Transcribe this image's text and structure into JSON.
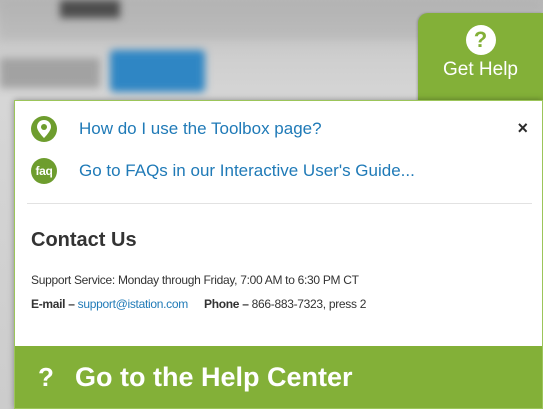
{
  "get_help_tab": {
    "icon": "question-circle-icon",
    "label": "Get Help"
  },
  "popup": {
    "links": [
      {
        "icon": "map-pin-icon",
        "label": "How do I use the Toolbox page?"
      },
      {
        "icon": "faq-icon",
        "icon_text": "faq",
        "label": "Go to FAQs in our Interactive User's Guide..."
      }
    ],
    "close_label": "×",
    "contact": {
      "title": "Contact Us",
      "support_hours": "Support Service: Monday through Friday, 7:00 AM to 6:30 PM CT",
      "email_label": "E-mail –",
      "email": "support@istation.com",
      "phone_label": "Phone –",
      "phone": "866-883-7323, press 2"
    },
    "help_center": {
      "icon_text": "?",
      "label": "Go to the Help Center"
    }
  },
  "colors": {
    "accent_green": "#83b038",
    "icon_green": "#6e9d2e",
    "link_blue": "#1f7ab7"
  }
}
